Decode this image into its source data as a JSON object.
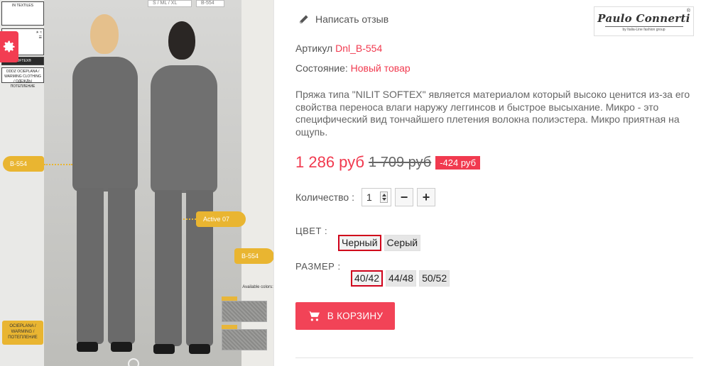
{
  "product_image": {
    "tags": [
      "B-554",
      "Active 07",
      "B-554"
    ],
    "label_boxes": [
      "IN TEXTILES",
      "SOFTEX®",
      "ODDZ OCIEPLANA / WARMING CLOTHING / ОДЕЖДЫ ПОТЕПЛЕНИЕ"
    ],
    "size_tags": [
      "S / ML / XL",
      "B-554"
    ],
    "available_colors": "Available colors:",
    "bottom_badge": "OCIEPLANA / WARMING / ПОТЕПЛЕНИЕ",
    "colors": {
      "accent": "#f13a4f",
      "tag_gold": "#e9b531"
    }
  },
  "review": {
    "label": "Написать отзыв",
    "icon": "pencil-icon"
  },
  "brand": {
    "name": "Paulo Connerti",
    "sub": "by Italia-Line fashion group",
    "reg": "®"
  },
  "sku": {
    "label": "Артикул",
    "value": "Dnl_B-554"
  },
  "condition": {
    "label": "Состояние:",
    "value": "Новый товар"
  },
  "description": "Пряжа типа \"NILIT SOFTEX\" является материалом который высоко ценится из-за его свойства переноса влаги наружу леггинсов и быстрое высыхание. Микро - это специфический вид тончайшего плетения волокна полиэстера. Микро приятная на ощупь.",
  "price": {
    "current": "1 286 руб",
    "old": "1 709 руб",
    "discount": "-424 руб"
  },
  "quantity": {
    "label": "Количество :",
    "value": "1",
    "minus": "−",
    "plus": "+"
  },
  "color": {
    "label": "ЦВЕТ :",
    "options": [
      "Черный",
      "Серый"
    ],
    "selected": "Черный"
  },
  "size": {
    "label": "РАЗМЕР :",
    "options": [
      "40/42",
      "44/48",
      "50/52"
    ],
    "selected": "40/42"
  },
  "cart": {
    "label": "В КОРЗИНУ",
    "icon": "shopping-cart-icon"
  }
}
